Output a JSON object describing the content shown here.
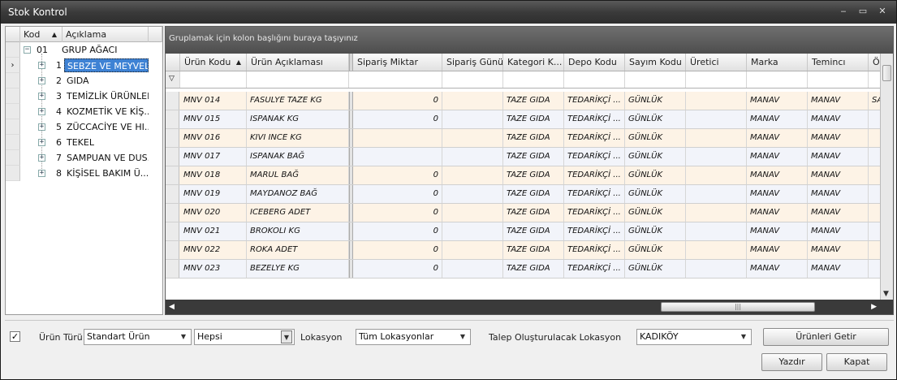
{
  "window": {
    "title": "Stok Kontrol",
    "controls": [
      "‒",
      "▭",
      "✕"
    ]
  },
  "tree": {
    "headers": {
      "code": "Kod",
      "desc": "Açıklama"
    },
    "root": {
      "code": "01",
      "desc": "GRUP AĞACI"
    },
    "items": [
      {
        "code": "1",
        "desc": "SEBZE VE MEYVELER"
      },
      {
        "code": "2",
        "desc": "GIDA"
      },
      {
        "code": "3",
        "desc": "TEMİZLİK ÜRÜNLERİ"
      },
      {
        "code": "4",
        "desc": "KOZMETİK VE KİŞ..."
      },
      {
        "code": "5",
        "desc": "ZÜCCACİYE VE HI..."
      },
      {
        "code": "6",
        "desc": "TEKEL"
      },
      {
        "code": "7",
        "desc": "SAMPUAN VE DUS..."
      },
      {
        "code": "8",
        "desc": "KİŞİSEL BAKIM Ü..."
      }
    ]
  },
  "grid": {
    "group_hint": "Gruplamak için kolon başlığını buraya taşıyınız",
    "columns": [
      "Ürün Kodu",
      "Ürün Açıklaması",
      "Sipariş Miktar",
      "Sipariş Günü",
      "Kategori K...",
      "Depo Kodu",
      "Sayım Kodu",
      "Üretici",
      "Marka",
      "Temincı",
      "Ö"
    ],
    "rows": [
      {
        "code": "MNV 014",
        "desc": "FASULYE TAZE KG",
        "qty": "0",
        "day": "",
        "cat": "TAZE GIDA",
        "depo": "TEDARİKÇİ ...",
        "sayim": "GÜNLÜK",
        "uretici": "",
        "marka": "MANAV",
        "temin": "MANAV",
        "extra": "SA"
      },
      {
        "code": "MNV 015",
        "desc": "ISPANAK  KG",
        "qty": "0",
        "day": "",
        "cat": "TAZE GIDA",
        "depo": "TEDARİKÇİ ...",
        "sayim": "GÜNLÜK",
        "uretici": "",
        "marka": "MANAV",
        "temin": "MANAV",
        "extra": ""
      },
      {
        "code": "MNV 016",
        "desc": "KIVI INCE KG",
        "qty": "",
        "day": "",
        "cat": "TAZE GIDA",
        "depo": "TEDARİKÇİ ...",
        "sayim": "GÜNLÜK",
        "uretici": "",
        "marka": "MANAV",
        "temin": "MANAV",
        "extra": ""
      },
      {
        "code": "MNV 017",
        "desc": "ISPANAK BAĞ",
        "qty": "",
        "day": "",
        "cat": "TAZE GIDA",
        "depo": "TEDARİKÇİ ...",
        "sayim": "GÜNLÜK",
        "uretici": "",
        "marka": "MANAV",
        "temin": "MANAV",
        "extra": ""
      },
      {
        "code": "MNV 018",
        "desc": "MARUL BAĞ",
        "qty": "0",
        "day": "",
        "cat": "TAZE GIDA",
        "depo": "TEDARİKÇİ ...",
        "sayim": "GÜNLÜK",
        "uretici": "",
        "marka": "MANAV",
        "temin": "MANAV",
        "extra": ""
      },
      {
        "code": "MNV 019",
        "desc": "MAYDANOZ BAĞ",
        "qty": "0",
        "day": "",
        "cat": "TAZE GIDA",
        "depo": "TEDARİKÇİ ...",
        "sayim": "GÜNLÜK",
        "uretici": "",
        "marka": "MANAV",
        "temin": "MANAV",
        "extra": ""
      },
      {
        "code": "MNV 020",
        "desc": "ICEBERG ADET",
        "qty": "0",
        "day": "",
        "cat": "TAZE GIDA",
        "depo": "TEDARİKÇİ ...",
        "sayim": "GÜNLÜK",
        "uretici": "",
        "marka": "MANAV",
        "temin": "MANAV",
        "extra": ""
      },
      {
        "code": "MNV 021",
        "desc": "BROKOLI KG",
        "qty": "0",
        "day": "",
        "cat": "TAZE GIDA",
        "depo": "TEDARİKÇİ ...",
        "sayim": "GÜNLÜK",
        "uretici": "",
        "marka": "MANAV",
        "temin": "MANAV",
        "extra": ""
      },
      {
        "code": "MNV 022",
        "desc": "ROKA ADET",
        "qty": "0",
        "day": "",
        "cat": "TAZE GIDA",
        "depo": "TEDARİKÇİ ...",
        "sayim": "GÜNLÜK",
        "uretici": "",
        "marka": "MANAV",
        "temin": "MANAV",
        "extra": ""
      },
      {
        "code": "MNV 023",
        "desc": "BEZELYE  KG",
        "qty": "0",
        "day": "",
        "cat": "TAZE GIDA",
        "depo": "TEDARİKÇİ ...",
        "sayim": "GÜNLÜK",
        "uretici": "",
        "marka": "MANAV",
        "temin": "MANAV",
        "extra": ""
      }
    ]
  },
  "filters": {
    "checkbox_mark": "✓",
    "urun_turu_label": "Ürün Türü",
    "urun_turu_value": "Standart Ürün",
    "hepsi_value": "Hepsi",
    "lokasyon_label": "Lokasyon",
    "lokasyon_value": "Tüm Lokasyonlar",
    "talep_label": "Talep Oluşturulacak Lokasyon",
    "talep_value": "KADIKÖY",
    "getir_button": "Ürünleri Getir"
  },
  "actions": {
    "print_button": "Yazdır",
    "close_button": "Kapat"
  }
}
